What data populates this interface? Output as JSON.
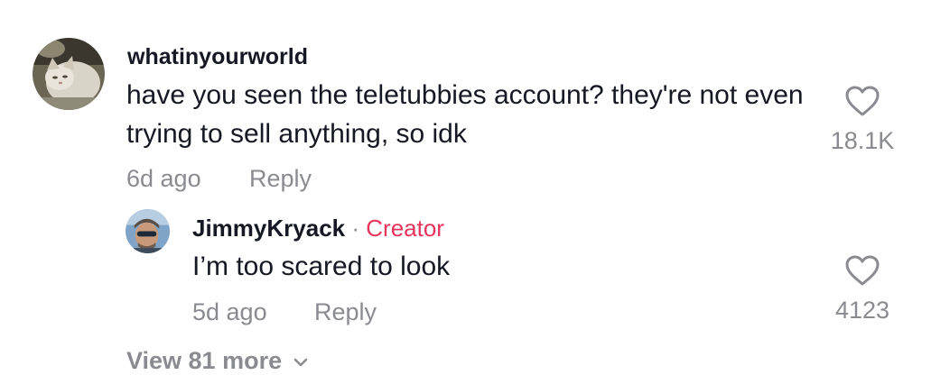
{
  "comments": [
    {
      "username": "whatinyourworld",
      "text": "have you seen the teletubbies account? they're not even trying to sell anything, so idk",
      "time": "6d ago",
      "reply_label": "Reply",
      "likes": "18.1K",
      "avatar_icon": "cat-avatar",
      "like_icon": "heart-outline-icon"
    }
  ],
  "replies": [
    {
      "username": "JimmyKryack",
      "separator": "·",
      "badge": "Creator",
      "text": "I’m too scared to look",
      "time": "5d ago",
      "reply_label": "Reply",
      "likes": "4123",
      "avatar_icon": "person-sunglasses-avatar",
      "like_icon": "heart-outline-icon"
    }
  ],
  "view_more": {
    "label": "View 81 more",
    "icon": "chevron-down-icon"
  },
  "colors": {
    "text_primary": "#161823",
    "text_secondary": "#8a8b91",
    "creator_badge": "#e8345c",
    "background": "#ffffff"
  }
}
